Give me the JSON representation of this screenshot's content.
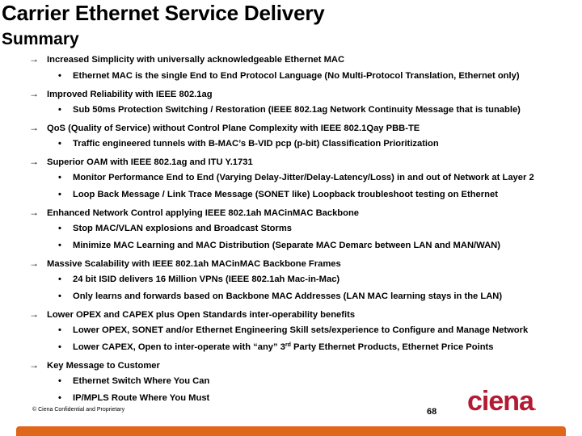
{
  "slide": {
    "title": "Carrier Ethernet Service Delivery",
    "subtitle": "Summary",
    "arrow_glyph": "→",
    "bullet_glyph": "•",
    "items": [
      {
        "text": "Increased Simplicity with universally acknowledgeable Ethernet MAC",
        "subitems": [
          "Ethernet MAC is the single End to End Protocol Language (No Multi-Protocol Translation, Ethernet only)"
        ]
      },
      {
        "text": "Improved Reliability with IEEE 802.1ag",
        "subitems": [
          "Sub 50ms Protection Switching / Restoration (IEEE 802.1ag Network Continuity Message that is tunable)"
        ]
      },
      {
        "text": "QoS (Quality of Service) without Control Plane Complexity with IEEE 802.1Qay PBB-TE",
        "subitems": [
          "Traffic engineered tunnels with B-MAC’s B-VID pcp (p-bit) Classification Prioritization"
        ]
      },
      {
        "text": "Superior OAM with IEEE 802.1ag and ITU Y.1731",
        "subitems": [
          "Monitor Performance End to End (Varying Delay-Jitter/Delay-Latency/Loss) in and out of Network at Layer 2",
          "Loop Back Message / Link Trace Message (SONET like) Loopback troubleshoot testing on Ethernet"
        ]
      },
      {
        "text": "Enhanced Network Control applying IEEE 802.1ah MACinMAC Backbone",
        "subitems": [
          "Stop MAC/VLAN explosions and Broadcast Storms",
          "Minimize MAC Learning and MAC Distribution (Separate MAC Demarc between LAN and MAN/WAN)"
        ]
      },
      {
        "text": "Massive Scalability with IEEE 802.1ah MACinMAC Backbone Frames",
        "subitems": [
          "24 bit ISID delivers 16 Million VPNs (IEEE 802.1ah Mac-in-Mac)",
          "Only learns and forwards based on Backbone MAC Addresses (LAN MAC learning stays in the LAN)"
        ]
      },
      {
        "text": "Lower OPEX and CAPEX plus Open Standards inter-operability benefits",
        "subitems": [
          "Lower OPEX, SONET and/or Ethernet Engineering Skill sets/experience to Configure and Manage Network",
          "Lower CAPEX, Open to inter-operate with “any” 3rd Party Ethernet Products, Ethernet Price Points"
        ]
      },
      {
        "text": "Key Message to Customer",
        "subitems": [
          "Ethernet Switch Where You Can",
          "IP/MPLS Route Where You Must"
        ]
      }
    ]
  },
  "capex_sub": {
    "pre": "Lower CAPEX, Open to inter-operate with “any” 3",
    "sup": "rd",
    "post": " Party Ethernet Products, Ethernet Price Points"
  },
  "footer": {
    "copyright": "© Ciena Confidential and Proprietary",
    "page_number": "68",
    "logo_text": "ciena",
    "logo_dot": ".",
    "brand_color": "#b31b34",
    "bar_color": "#e0661a"
  }
}
